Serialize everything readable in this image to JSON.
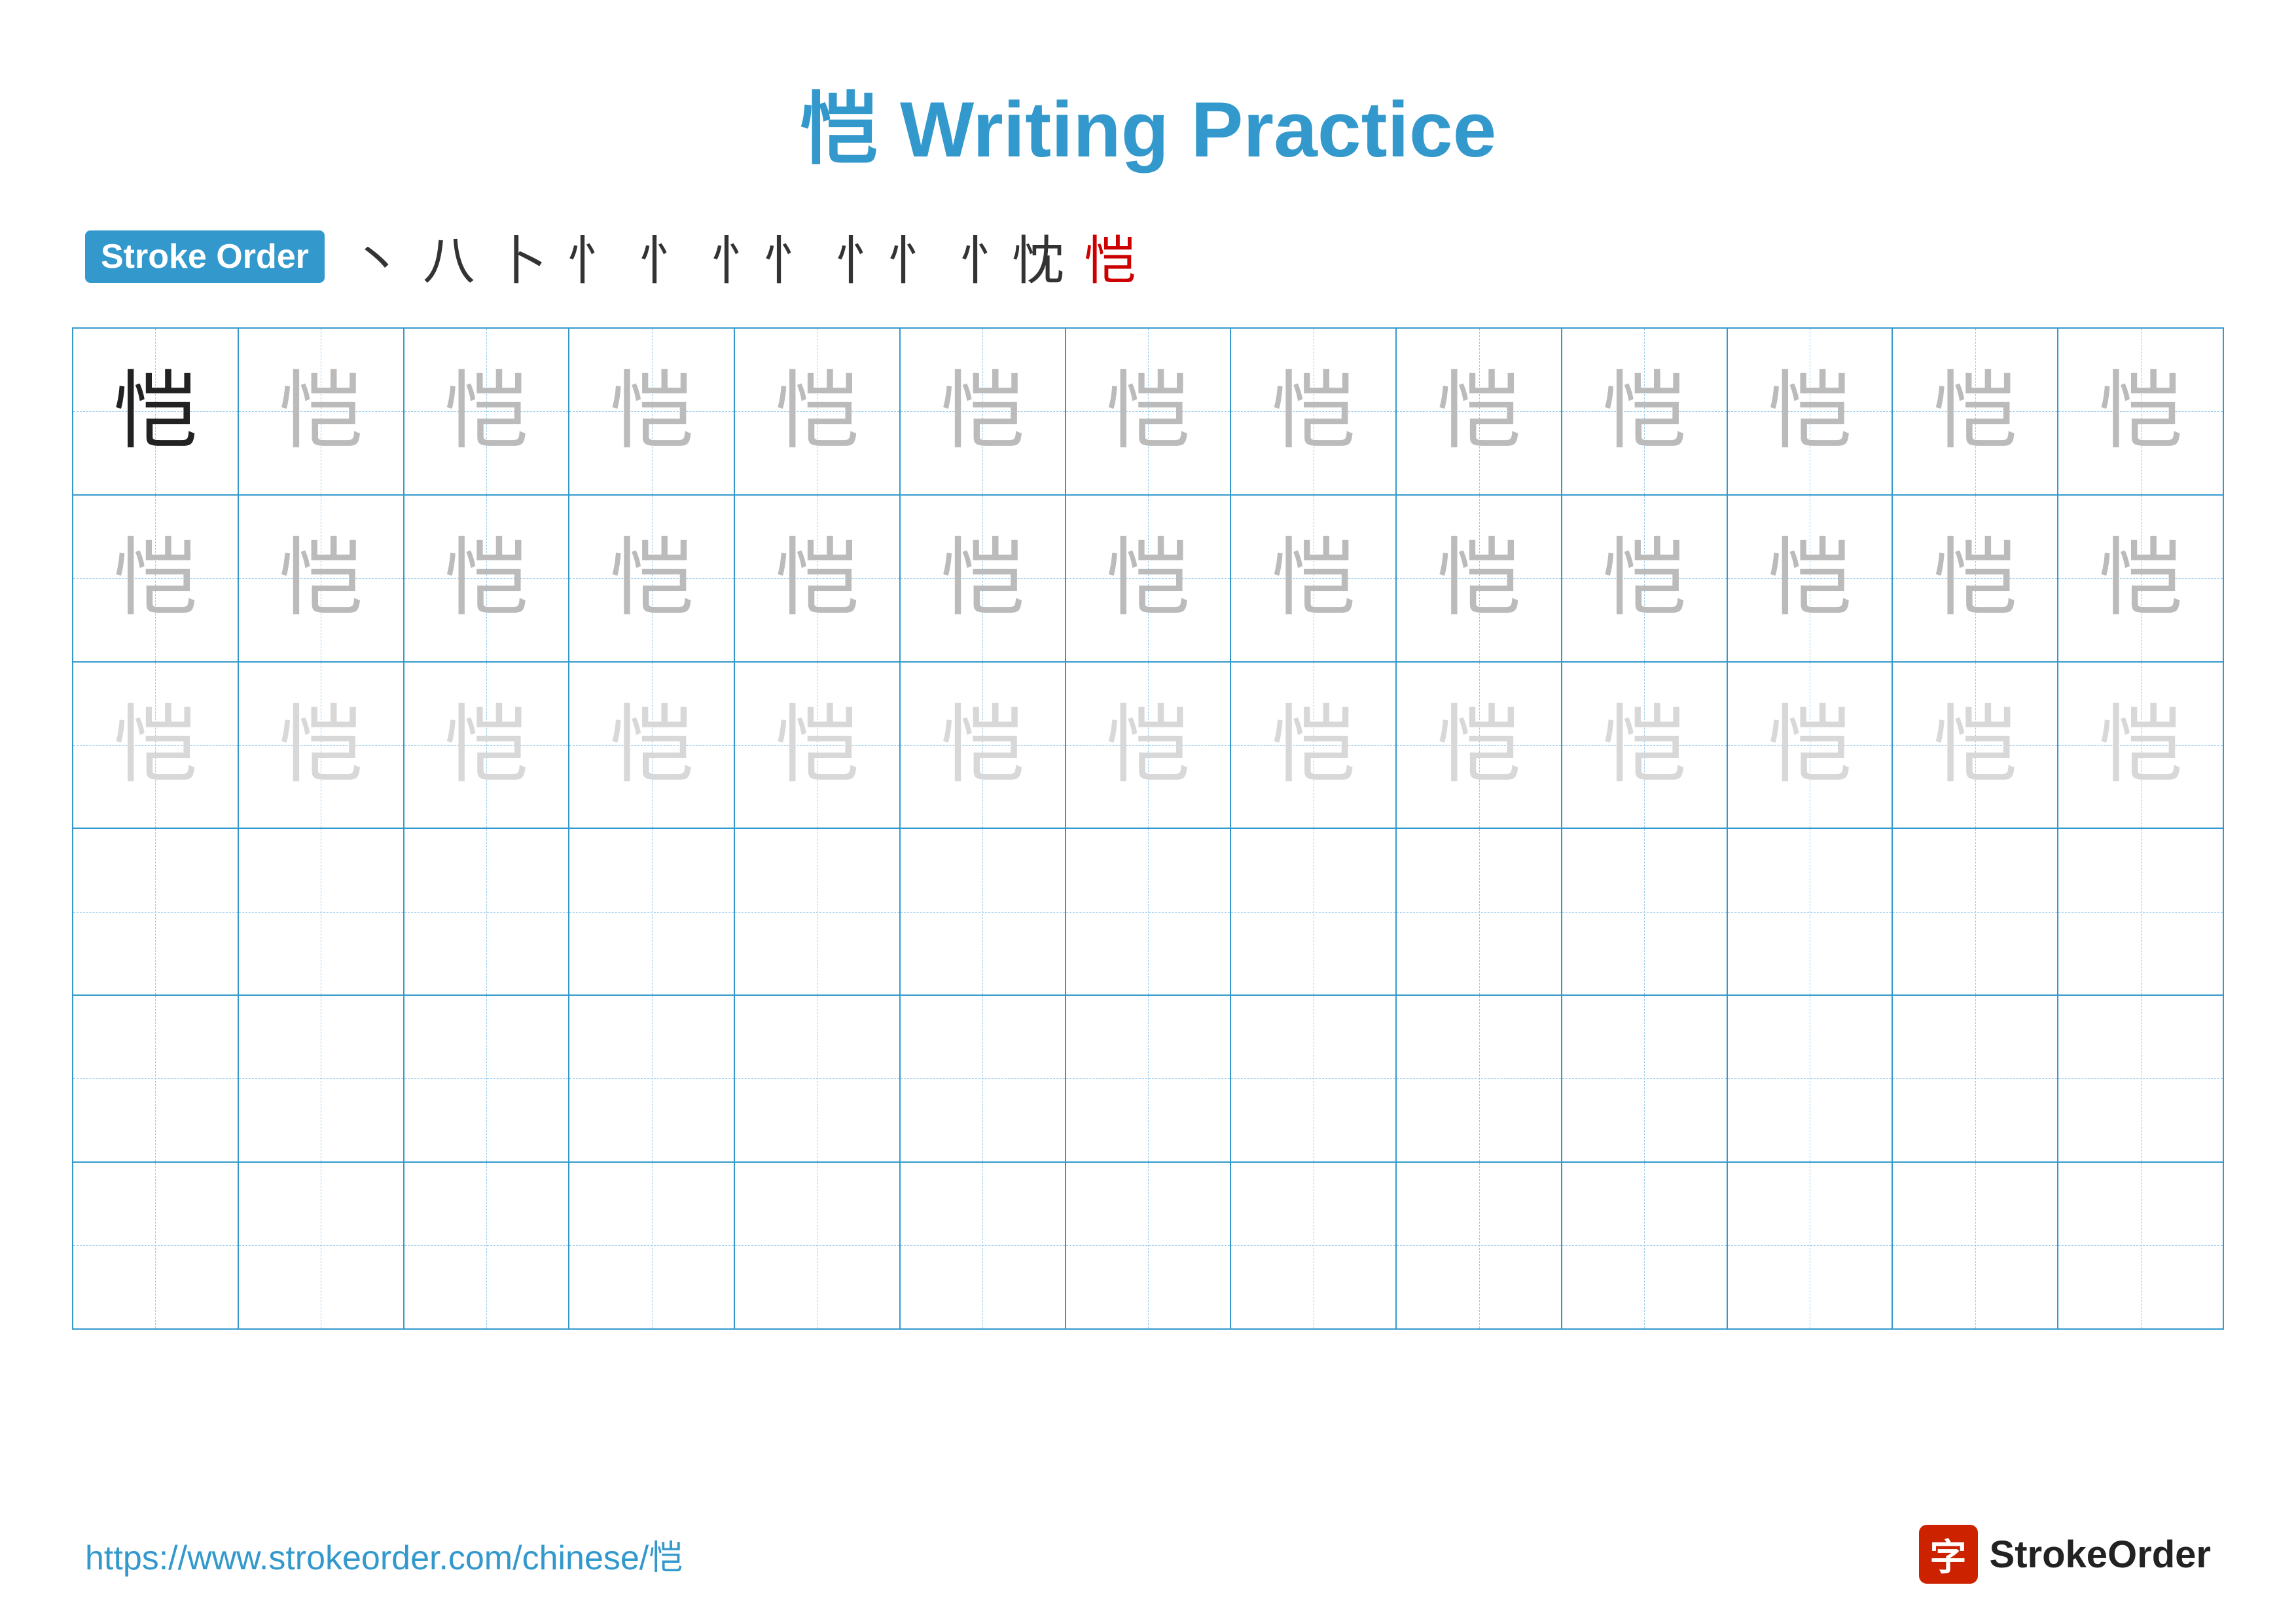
{
  "title": {
    "character": "恺",
    "label": " Writing Practice",
    "full": "恺 Writing Practice"
  },
  "stroke_order": {
    "badge_label": "Stroke Order",
    "strokes": [
      "丶",
      "八",
      "卜",
      "忄",
      "忄",
      "忄忄",
      "忄忄",
      "忄忱",
      "恺"
    ]
  },
  "grid": {
    "rows": 6,
    "cols": 13,
    "character": "恺",
    "row_styles": [
      "dark",
      "medium-gray",
      "light-gray",
      "empty",
      "empty",
      "empty"
    ]
  },
  "footer": {
    "url": "https://www.strokeorder.com/chinese/恺",
    "logo_char": "字",
    "logo_text": "StrokeOrder"
  }
}
